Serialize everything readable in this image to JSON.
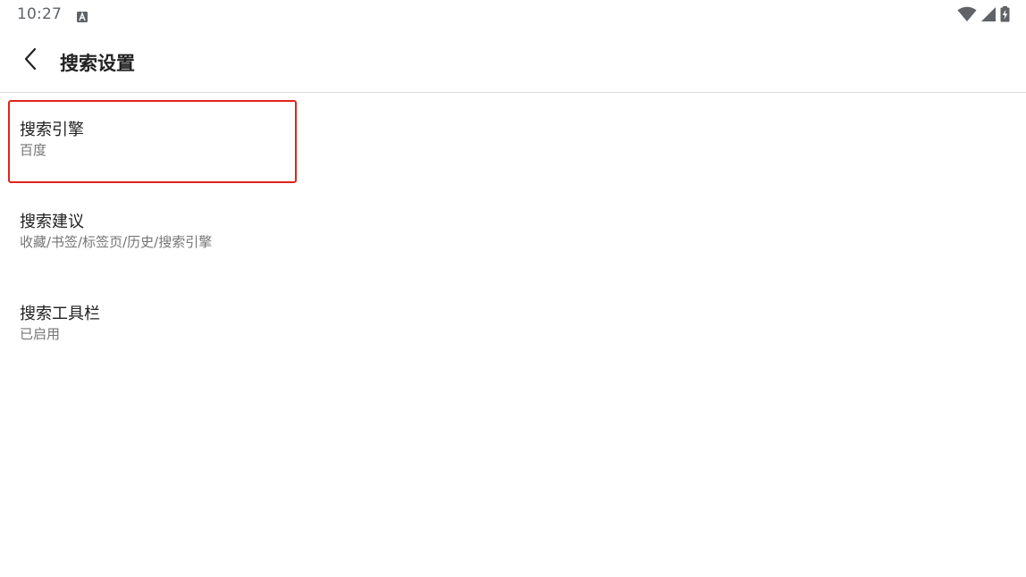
{
  "status_bar": {
    "time": "10:27",
    "notification_icon": "keyboard-a-icon",
    "icons": [
      "wifi-icon",
      "cell-signal-icon",
      "battery-charging-icon"
    ]
  },
  "toolbar": {
    "back_icon": "chevron-left-icon",
    "title": "搜索设置"
  },
  "items": [
    {
      "title": "搜索引擎",
      "summary": "百度"
    },
    {
      "title": "搜索建议",
      "summary": "收藏/书签/标签页/历史/搜索引擎"
    },
    {
      "title": "搜索工具栏",
      "summary": "已启用"
    }
  ],
  "colors": {
    "highlight": "#e0241b",
    "title_text": "#212121",
    "summary_text": "#757575",
    "divider": "#dcdcdc"
  }
}
